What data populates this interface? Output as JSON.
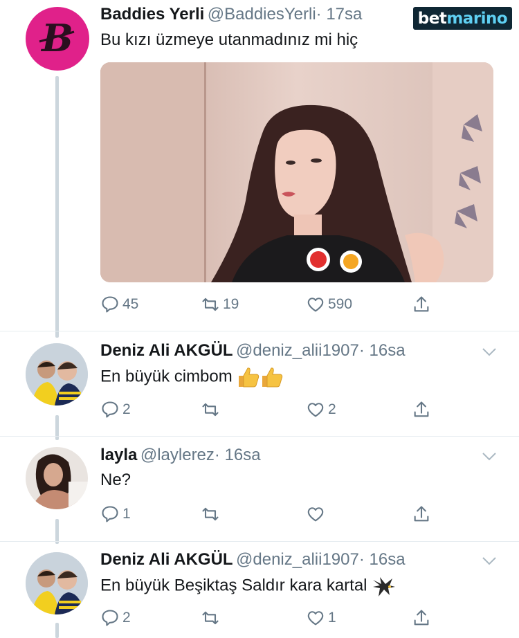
{
  "watermark": {
    "part1": "bet",
    "part2": "marino"
  },
  "tweets": [
    {
      "name": "Baddies Yerli",
      "handle": "@BaddiesYerli",
      "time": "· 17sa",
      "text": "Bu kızı üzmeye utanmadınız mi hiç",
      "replies": "45",
      "retweets": "19",
      "likes": "590"
    },
    {
      "name": "Deniz Ali AKGÜL",
      "handle": "@deniz_alii1907",
      "time": "· 16sa",
      "text": "En büyük cimbom",
      "replies": "2",
      "retweets": "",
      "likes": "2"
    },
    {
      "name": "layla",
      "handle": "@laylerez",
      "time": "· 16sa",
      "text": "Ne?",
      "replies": "1",
      "retweets": "",
      "likes": ""
    },
    {
      "name": "Deniz Ali AKGÜL",
      "handle": "@deniz_alii1907",
      "time": "· 16sa",
      "text": "En büyük Beşiktaş Saldır kara kartal",
      "replies": "2",
      "retweets": "",
      "likes": "1"
    }
  ],
  "colors": {
    "accent_pink": "#e0218a",
    "icon_gray": "#657786",
    "thread_line": "#ccd6dd",
    "watermark_bg": "#0f2734",
    "watermark_accent": "#5fd0f3"
  },
  "icons": [
    "reply-icon",
    "retweet-icon",
    "like-icon",
    "share-icon",
    "chevron-down-icon",
    "thumbs-up-icon",
    "eagle-icon"
  ]
}
